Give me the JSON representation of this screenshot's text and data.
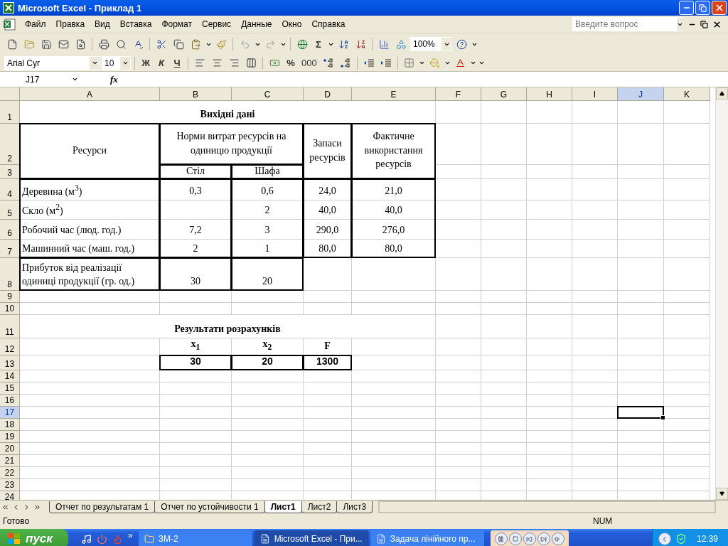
{
  "window": {
    "title": "Microsoft Excel - Приклад 1"
  },
  "menu": [
    "Файл",
    "Правка",
    "Вид",
    "Вставка",
    "Формат",
    "Сервис",
    "Данные",
    "Окно",
    "Справка"
  ],
  "help_box": {
    "placeholder": "Введите вопрос"
  },
  "toolbar": {
    "sum": "Σ",
    "zoom": "100%"
  },
  "format_bar": {
    "font": "Arial Cyr",
    "size": "10",
    "bold": "Ж",
    "italic": "К",
    "underline": "Ч",
    "percent": "%",
    "thousands": "000"
  },
  "formula_bar": {
    "name_box": "J17",
    "function_label": "fx"
  },
  "sheet": {
    "columns": [
      "A",
      "B",
      "C",
      "D",
      "E",
      "F",
      "G",
      "H",
      "I",
      "J",
      "K"
    ],
    "rows": [
      {
        "number": "1",
        "cells": [
          {
            "kind": "title",
            "text": "Вихідні дані"
          }
        ]
      },
      {
        "number": "2",
        "cells": [
          {
            "kind": "header",
            "text": "Ресурси"
          },
          {
            "kind": "header",
            "text": "Норми витрат ресурсів на одиницю продукції"
          },
          {
            "kind": "header",
            "text": "Запаси ресурсів"
          },
          {
            "kind": "header",
            "text": "Фактичне використання ресурсів"
          }
        ]
      },
      {
        "number": "3",
        "cells": [
          {
            "kind": "header",
            "text": "Стіл"
          },
          {
            "kind": "header",
            "text": "Шафа"
          }
        ]
      },
      {
        "number": "4",
        "cells": [
          {
            "kind": "label",
            "text": "Деревина (м$^{3}$)"
          },
          {
            "kind": "number",
            "text": "0,3"
          },
          {
            "kind": "number",
            "text": "0,6"
          },
          {
            "kind": "number",
            "text": "24,0"
          },
          {
            "kind": "number",
            "text": "21,0"
          }
        ]
      },
      {
        "number": "5",
        "cells": [
          {
            "kind": "label",
            "text": "Скло (м$^{2}$)"
          },
          {
            "kind": "number",
            "text": "2"
          },
          {
            "kind": "number",
            "text": "40,0"
          },
          {
            "kind": "number",
            "text": "40,0"
          }
        ]
      },
      {
        "number": "6",
        "cells": [
          {
            "kind": "label",
            "text": "Робочий час (люд. год.)"
          },
          {
            "kind": "number",
            "text": "7,2"
          },
          {
            "kind": "number",
            "text": "3"
          },
          {
            "kind": "number",
            "text": "290,0"
          },
          {
            "kind": "number",
            "text": "276,0"
          }
        ]
      },
      {
        "number": "7",
        "cells": [
          {
            "kind": "label",
            "text": "Машинний час (маш. год.)"
          },
          {
            "kind": "number",
            "text": "2"
          },
          {
            "kind": "number",
            "text": "1"
          },
          {
            "kind": "number",
            "text": "80,0"
          },
          {
            "kind": "number",
            "text": "80,0"
          }
        ]
      },
      {
        "number": "8",
        "cells": [
          {
            "kind": "label",
            "text": "Прибуток від реалізації одиниці продукції (гр. од.)"
          },
          {
            "kind": "number",
            "text": "30"
          },
          {
            "kind": "number",
            "text": "20"
          }
        ]
      },
      {
        "number": "9"
      },
      {
        "number": "10"
      },
      {
        "number": "11",
        "cells": [
          {
            "kind": "title",
            "text": "Результати розрахунків"
          }
        ]
      },
      {
        "number": "12",
        "cells": [
          {
            "kind": "var",
            "text": "x$_{1}$"
          },
          {
            "kind": "var",
            "text": "x$_{2}$"
          },
          {
            "kind": "var",
            "text": "F"
          }
        ]
      },
      {
        "number": "13",
        "cells": [
          {
            "kind": "result",
            "text": "30"
          },
          {
            "kind": "result",
            "text": "20"
          },
          {
            "kind": "result",
            "text": "1300"
          }
        ]
      },
      {
        "number": "14"
      },
      {
        "number": "15"
      },
      {
        "number": "16"
      },
      {
        "number": "17"
      },
      {
        "number": "18"
      },
      {
        "number": "19"
      },
      {
        "number": "20"
      },
      {
        "number": "21"
      },
      {
        "number": "22"
      },
      {
        "number": "23"
      },
      {
        "number": "24"
      }
    ]
  },
  "sheet_tabs": [
    {
      "label": "Отчет по результатам 1",
      "selected": false
    },
    {
      "label": "Отчет по устойчивости 1",
      "selected": false
    },
    {
      "label": "Лист1",
      "selected": true
    },
    {
      "label": "Лист2",
      "selected": false
    },
    {
      "label": "Лист3",
      "selected": false
    }
  ],
  "status_bar": {
    "text": "Готово",
    "num": "NUM"
  },
  "taskbar": {
    "start": "пуск",
    "more": "»",
    "tasks": [
      {
        "label": "ЗМ-2",
        "selected": false
      },
      {
        "label": "Microsoft Excel - При...",
        "selected": true
      },
      {
        "label": "Задача лінійного пр...",
        "selected": false
      }
    ],
    "clock": "12:39"
  }
}
